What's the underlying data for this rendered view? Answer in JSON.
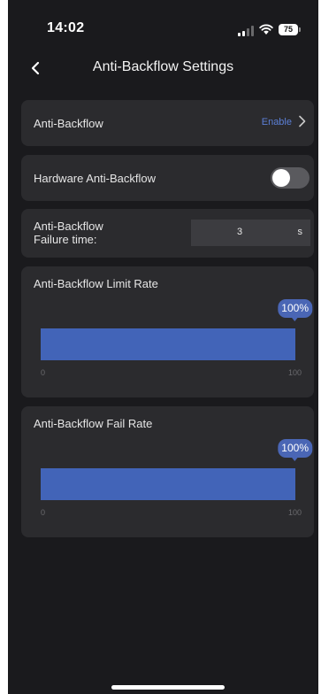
{
  "status_bar": {
    "time": "14:02",
    "battery": "75"
  },
  "header": {
    "title": "Anti-Backflow Settings"
  },
  "anti_backflow": {
    "label": "Anti-Backflow",
    "value": "Enable"
  },
  "hardware_anti_backflow": {
    "label": "Hardware Anti-Backflow",
    "enabled": false
  },
  "failure_time": {
    "label_line1": "Anti-Backflow",
    "label_line2": "Failure time:",
    "value": "3",
    "unit": "s"
  },
  "limit_rate": {
    "title": "Anti-Backflow Limit Rate",
    "value": 100,
    "badge": "100%",
    "min_label": "0",
    "max_label": "100"
  },
  "fail_rate": {
    "title": "Anti-Backflow Fail Rate",
    "value": 100,
    "badge": "100%",
    "min_label": "0",
    "max_label": "100"
  },
  "colors": {
    "background": "#1a1a1d",
    "card": "#2b2b2e",
    "accent": "#4264b8",
    "link": "#5b7fd6"
  }
}
